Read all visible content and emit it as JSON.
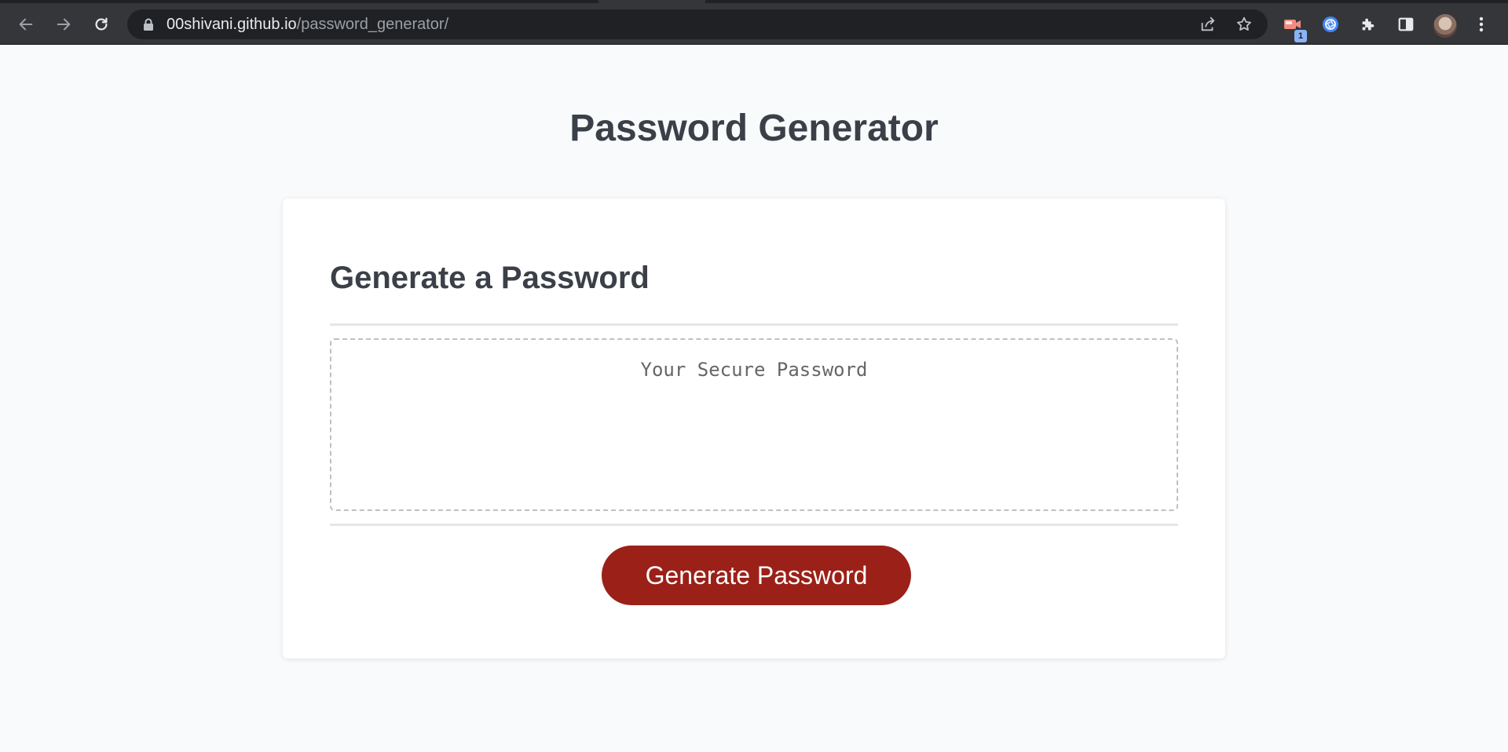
{
  "browser": {
    "url_host": "00shivani.github.io",
    "url_path": "/password_generator/",
    "extension_badge_count": "1",
    "colors": {
      "toolbar": "#35363a",
      "omnibox": "#202124",
      "icon": "#e8eaed"
    }
  },
  "page": {
    "title": "Password Generator"
  },
  "card": {
    "heading": "Generate a Password",
    "password_placeholder": "Your Secure Password",
    "generate_button_label": "Generate Password"
  },
  "colors": {
    "background": "#f9fafb",
    "text": "#3b4048",
    "button": "#9b2118",
    "button_text": "#ffffff"
  }
}
